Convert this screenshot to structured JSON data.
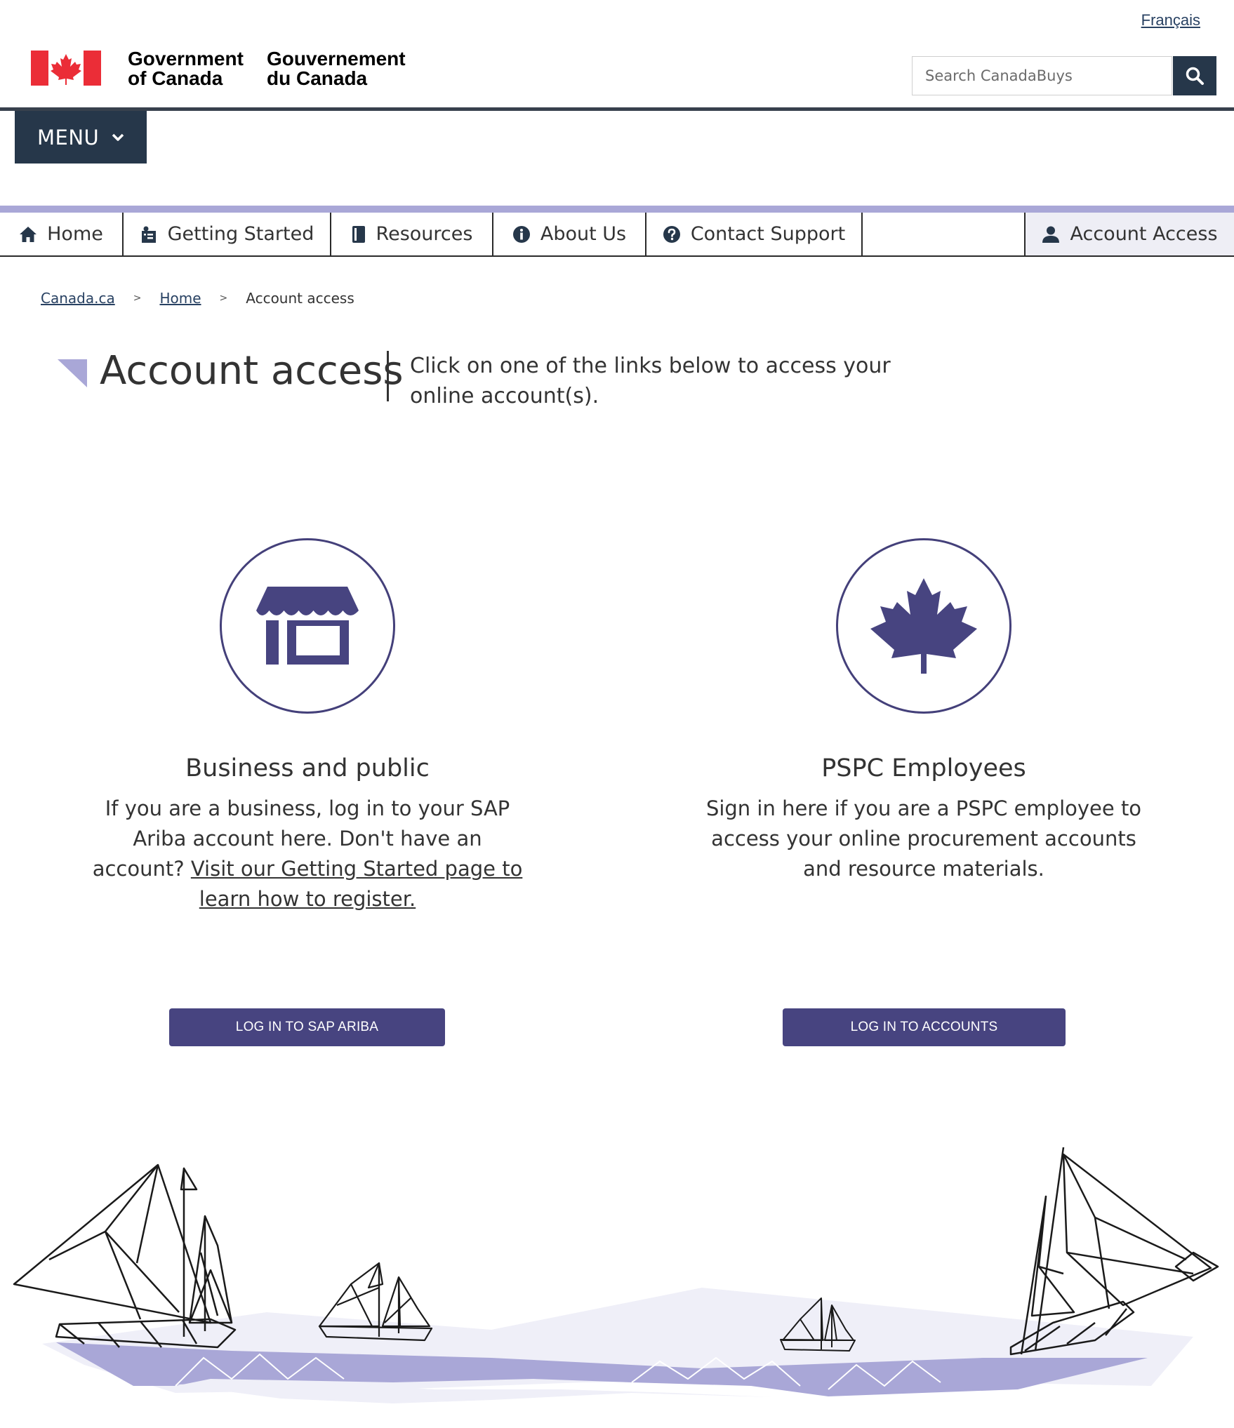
{
  "header": {
    "language_link": "Français",
    "gov_en_line1": "Government",
    "gov_en_line2": "of Canada",
    "gov_fr_line1": "Gouvernement",
    "gov_fr_line2": "du Canada",
    "search_placeholder": "Search CanadaBuys",
    "menu_label": "MENU"
  },
  "nav": {
    "home": "Home",
    "getting_started": "Getting Started",
    "resources": "Resources",
    "about": "About Us",
    "contact": "Contact Support",
    "account": "Account Access"
  },
  "breadcrumb": {
    "items": [
      "Canada.ca",
      "Home",
      "Account access"
    ],
    "separator": ">"
  },
  "page": {
    "title": "Account access",
    "intro": "Click on one of the links below to access your online account(s)."
  },
  "cards": [
    {
      "title": "Business and public",
      "text": "If you are a business, log in to your SAP Ariba account here. Don't have an account?",
      "link": "Visit our Getting Started page to learn how to register.",
      "button": "LOG IN TO SAP ARIBA"
    },
    {
      "title": "PSPC Employees",
      "text": "Sign in here if you are a PSPC employee to access your online procurement accounts and resource materials.",
      "button": "LOG IN TO ACCOUNTS"
    }
  ],
  "colors": {
    "flag_red": "#eb2d37",
    "header_dark": "#26374a",
    "accent_purple": "#474480",
    "nav_rule": "#a9a7d7",
    "account_tab_bg": "#eeeef5"
  },
  "icons": [
    "canada-flag-icon",
    "search-icon",
    "chevron-down-icon",
    "home-icon",
    "getting-started-icon",
    "book-icon",
    "info-icon",
    "help-icon",
    "user-icon",
    "storefront-icon",
    "maple-leaf-icon"
  ]
}
